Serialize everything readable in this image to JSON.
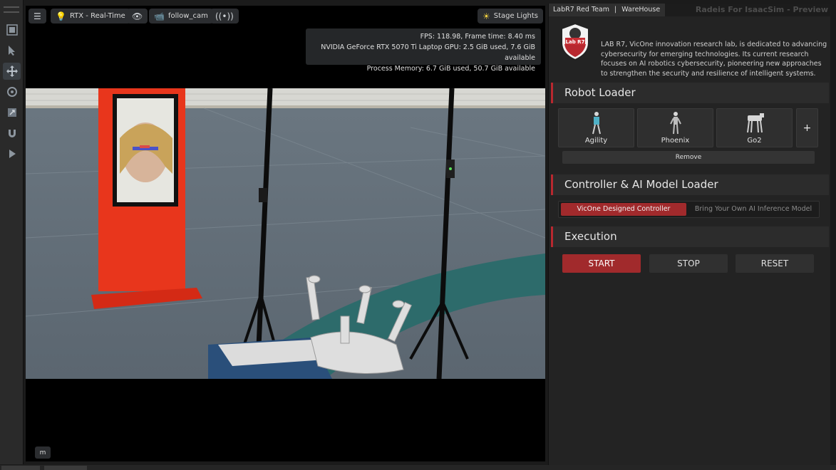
{
  "viewport": {
    "toolbar": {
      "renderer_label": "RTX - Real-Time",
      "camera_label": "follow_cam",
      "lighting_label": "Stage Lights"
    },
    "stats": {
      "fps_line": "FPS: 118.98, Frame time: 8.40 ms",
      "gpu_line": "NVIDIA GeForce RTX 5070 Ti Laptop GPU: 2.5 GiB used, 7.6 GiB available",
      "memory_line": "Process Memory: 6.7 GiB used, 50.7 GiB available"
    },
    "mode_chip": "m"
  },
  "left_toolbar": {
    "tools": [
      "layout-icon",
      "select-icon",
      "move-icon",
      "rotate-icon",
      "scale-icon",
      "snap-icon",
      "play-icon"
    ]
  },
  "panel": {
    "tabs": [
      "LabR7 Red Team",
      "WareHouse"
    ],
    "tab_separator": "|",
    "title": "Radeis For IsaacSim - Preview",
    "logo_text": "Lab R7",
    "about": "LAB R7, VicOne innovation research lab, is dedicated to advancing cybersecurity for emerging technologies. Its current research focuses on AI robotics cybersecurity, pioneering new approaches to strengthen the security and resilience of intelligent systems.",
    "robot_loader": {
      "title": "Robot Loader",
      "robots": [
        "Agility",
        "Phoenix",
        "Go2"
      ],
      "add_label": "+",
      "remove_label": "Remove"
    },
    "controller_loader": {
      "title": "Controller & AI Model Loader",
      "options": [
        "VicOne Designed Controller",
        "Bring Your Own AI Inference Model"
      ],
      "selected": "VicOne Designed Controller"
    },
    "execution": {
      "title": "Execution",
      "start": "START",
      "stop": "STOP",
      "reset": "RESET"
    }
  },
  "colors": {
    "accent": "#a12a2c",
    "panel_bg": "#232323",
    "viewport_bg": "#000000"
  }
}
